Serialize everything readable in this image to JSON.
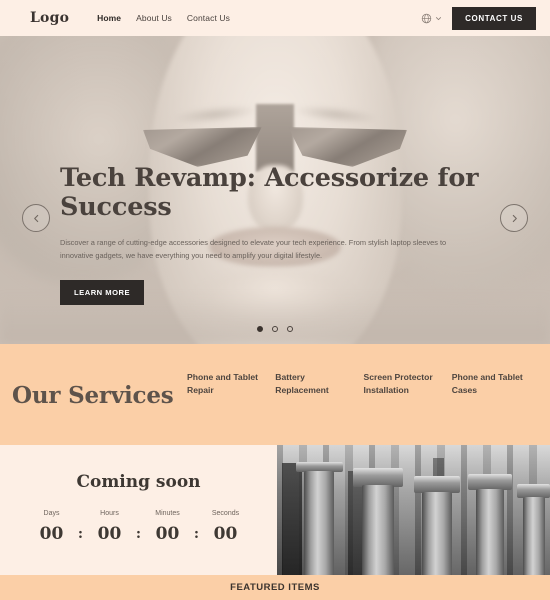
{
  "header": {
    "logo": "Logo",
    "nav": [
      {
        "label": "Home",
        "active": true
      },
      {
        "label": "About Us",
        "active": false
      },
      {
        "label": "Contact Us",
        "active": false
      }
    ],
    "language_icon": "globe-icon",
    "language_chevron": "chevron-down-icon",
    "contact_button": "CONTACT US"
  },
  "hero": {
    "title": "Tech Revamp: Accessorize for Success",
    "description": "Discover a range of cutting-edge accessories designed to elevate your tech experience. From stylish laptop sleeves to innovative gadgets, we have everything you need to amplify your digital lifestyle.",
    "cta": "LEARN MORE",
    "prev_icon": "chevron-left-icon",
    "next_icon": "chevron-right-icon",
    "slides": 3,
    "active_slide": 1,
    "image_alt": "woman wearing sunglasses and headscarf, sepia toned"
  },
  "services": {
    "title": "Our Services",
    "items": [
      "Phone and Tablet Repair",
      "Battery Replacement",
      "Screen Protector Installation",
      "Phone and Tablet Cases"
    ]
  },
  "coming_soon": {
    "title": "Coming soon",
    "units": [
      {
        "label": "Days",
        "value": "00"
      },
      {
        "label": "Hours",
        "value": "00"
      },
      {
        "label": "Minutes",
        "value": "00"
      },
      {
        "label": "Seconds",
        "value": "00"
      }
    ],
    "separator": ":",
    "image_alt": "black and white stone columns and carved capitals"
  },
  "featured": {
    "title": "FEATURED ITEMS"
  },
  "colors": {
    "cream": "#FDEFE5",
    "peach": "#FBCFA7",
    "dark": "#2E2A28",
    "text": "#4A423D",
    "muted": "#6A625C"
  }
}
